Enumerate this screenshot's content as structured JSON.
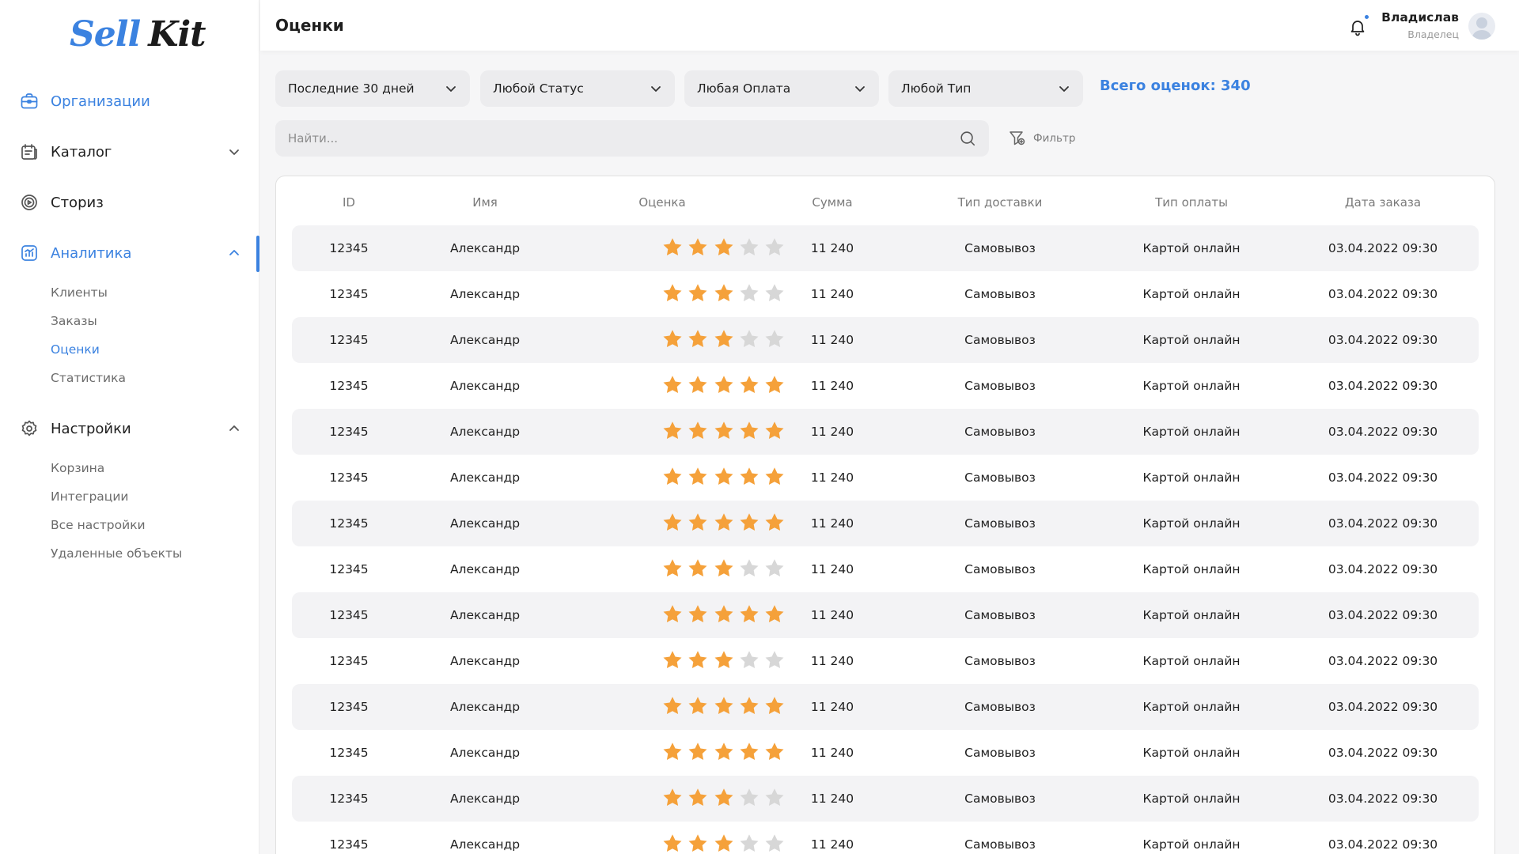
{
  "brand": {
    "part1": "Sell",
    "part2": "Kit"
  },
  "colors": {
    "accent": "#3b82e0",
    "star_on": "#f5a13a",
    "star_off": "#d7d7d7"
  },
  "sidebar": {
    "items": [
      {
        "label": "Организации",
        "icon": "briefcase-icon"
      },
      {
        "label": "Каталог",
        "icon": "catalog-icon"
      },
      {
        "label": "Сториз",
        "icon": "stories-icon"
      },
      {
        "label": "Аналитика",
        "icon": "analytics-icon",
        "subitems": [
          "Клиенты",
          "Заказы",
          "Оценки",
          "Статистика"
        ]
      },
      {
        "label": "Настройки",
        "icon": "gear-icon",
        "subitems": [
          "Корзина",
          "Интеграции",
          "Все настройки",
          "Удаленные объекты"
        ]
      }
    ]
  },
  "header": {
    "title": "Оценки",
    "user_name": "Владислав",
    "user_role": "Владелец"
  },
  "filters": {
    "period": "Последние 30 дней",
    "status": "Любой Статус",
    "payment": "Любая Оплата",
    "type": "Любой Тип",
    "total": "Всего оценок: 340"
  },
  "search": {
    "placeholder": "Найти...",
    "filter_label": "Фильтр"
  },
  "table": {
    "columns": [
      "ID",
      "Имя",
      "Оценка",
      "Сумма",
      "Тип доставки",
      "Тип оплаты",
      "Дата заказа"
    ],
    "rows": [
      {
        "id": "12345",
        "name": "Александр",
        "rating": 3,
        "sum": "11 240",
        "delivery": "Самовывоз",
        "payment": "Картой онлайн",
        "date": "03.04.2022 09:30"
      },
      {
        "id": "12345",
        "name": "Александр",
        "rating": 3,
        "sum": "11 240",
        "delivery": "Самовывоз",
        "payment": "Картой онлайн",
        "date": "03.04.2022 09:30"
      },
      {
        "id": "12345",
        "name": "Александр",
        "rating": 3,
        "sum": "11 240",
        "delivery": "Самовывоз",
        "payment": "Картой онлайн",
        "date": "03.04.2022 09:30"
      },
      {
        "id": "12345",
        "name": "Александр",
        "rating": 5,
        "sum": "11 240",
        "delivery": "Самовывоз",
        "payment": "Картой онлайн",
        "date": "03.04.2022 09:30"
      },
      {
        "id": "12345",
        "name": "Александр",
        "rating": 5,
        "sum": "11 240",
        "delivery": "Самовывоз",
        "payment": "Картой онлайн",
        "date": "03.04.2022 09:30"
      },
      {
        "id": "12345",
        "name": "Александр",
        "rating": 5,
        "sum": "11 240",
        "delivery": "Самовывоз",
        "payment": "Картой онлайн",
        "date": "03.04.2022 09:30"
      },
      {
        "id": "12345",
        "name": "Александр",
        "rating": 5,
        "sum": "11 240",
        "delivery": "Самовывоз",
        "payment": "Картой онлайн",
        "date": "03.04.2022 09:30"
      },
      {
        "id": "12345",
        "name": "Александр",
        "rating": 3,
        "sum": "11 240",
        "delivery": "Самовывоз",
        "payment": "Картой онлайн",
        "date": "03.04.2022 09:30"
      },
      {
        "id": "12345",
        "name": "Александр",
        "rating": 5,
        "sum": "11 240",
        "delivery": "Самовывоз",
        "payment": "Картой онлайн",
        "date": "03.04.2022 09:30"
      },
      {
        "id": "12345",
        "name": "Александр",
        "rating": 3,
        "sum": "11 240",
        "delivery": "Самовывоз",
        "payment": "Картой онлайн",
        "date": "03.04.2022 09:30"
      },
      {
        "id": "12345",
        "name": "Александр",
        "rating": 5,
        "sum": "11 240",
        "delivery": "Самовывоз",
        "payment": "Картой онлайн",
        "date": "03.04.2022 09:30"
      },
      {
        "id": "12345",
        "name": "Александр",
        "rating": 5,
        "sum": "11 240",
        "delivery": "Самовывоз",
        "payment": "Картой онлайн",
        "date": "03.04.2022 09:30"
      },
      {
        "id": "12345",
        "name": "Александр",
        "rating": 3,
        "sum": "11 240",
        "delivery": "Самовывоз",
        "payment": "Картой онлайн",
        "date": "03.04.2022 09:30"
      },
      {
        "id": "12345",
        "name": "Александр",
        "rating": 3,
        "sum": "11 240",
        "delivery": "Самовывоз",
        "payment": "Картой онлайн",
        "date": "03.04.2022 09:30"
      }
    ]
  }
}
